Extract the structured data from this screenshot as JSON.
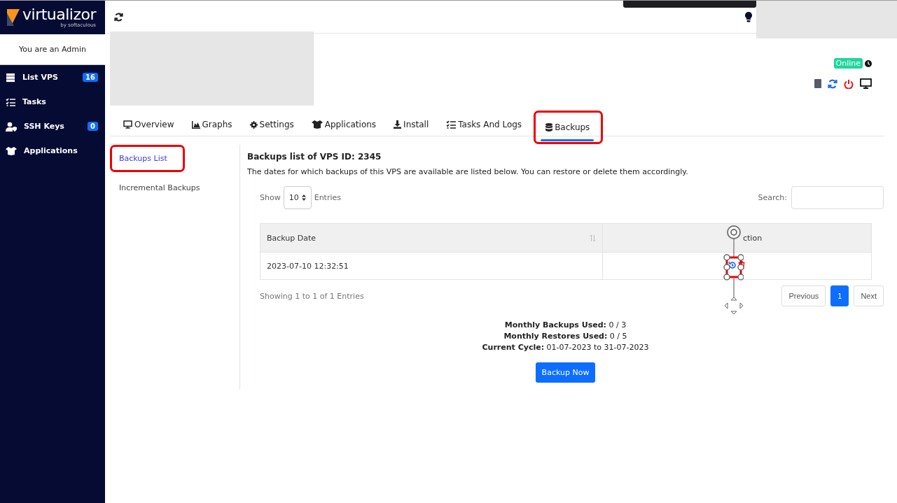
{
  "sidebar": {
    "logo": "virtualizor",
    "logo_sub": "by softaculous",
    "role": "You are an Admin",
    "items": [
      {
        "kind": "server",
        "label": "List VPS",
        "badge": "16"
      },
      {
        "kind": "tasks",
        "label": "Tasks"
      },
      {
        "kind": "key",
        "label": "SSH Keys",
        "badge": "0"
      },
      {
        "kind": "apps",
        "label": "Applications"
      }
    ]
  },
  "header": {
    "status": "Online"
  },
  "tabs": [
    {
      "kind": "monitor",
      "label": "Overview",
      "selected": false,
      "highlighted": false
    },
    {
      "kind": "chart",
      "label": "Graphs",
      "selected": false,
      "highlighted": false
    },
    {
      "kind": "gear",
      "label": "Settings",
      "selected": false,
      "highlighted": false
    },
    {
      "kind": "apps",
      "label": "Applications",
      "selected": false,
      "highlighted": false
    },
    {
      "kind": "download",
      "label": "Install",
      "selected": false,
      "highlighted": false
    },
    {
      "kind": "tasks",
      "label": "Tasks And Logs",
      "selected": false,
      "highlighted": false
    },
    {
      "kind": "database",
      "label": "Backups",
      "selected": true,
      "highlighted": true
    }
  ],
  "subnav": [
    {
      "label": "Backups List",
      "selected": true,
      "highlighted": true
    },
    {
      "label": "Incremental Backups",
      "selected": false,
      "highlighted": false
    }
  ],
  "panel": {
    "title": "Backups list of VPS ID: 2345",
    "description": "The dates for which backups of this VPS are available are listed below. You can restore or delete them accordingly.",
    "show_label": "Show",
    "page_size": "10",
    "entries_label": "Entries",
    "search_label": "Search:",
    "columns": [
      "Backup Date",
      "ction"
    ],
    "rows": [
      {
        "date": "2023-07-10 12:32:51"
      }
    ],
    "info": "Showing 1 to 1 of 1 Entries",
    "pagination": [
      {
        "label": "Previous",
        "selected": false
      },
      {
        "label": "1",
        "selected": true
      },
      {
        "label": "Next",
        "selected": false
      }
    ],
    "stats": [
      "**Monthly Backups Used:** 0 / 3",
      "**Monthly Restores Used:** 0 / 5",
      "**Current Cycle:** 01-07-2023 to 31-07-2023"
    ],
    "button": "Backup Now"
  }
}
